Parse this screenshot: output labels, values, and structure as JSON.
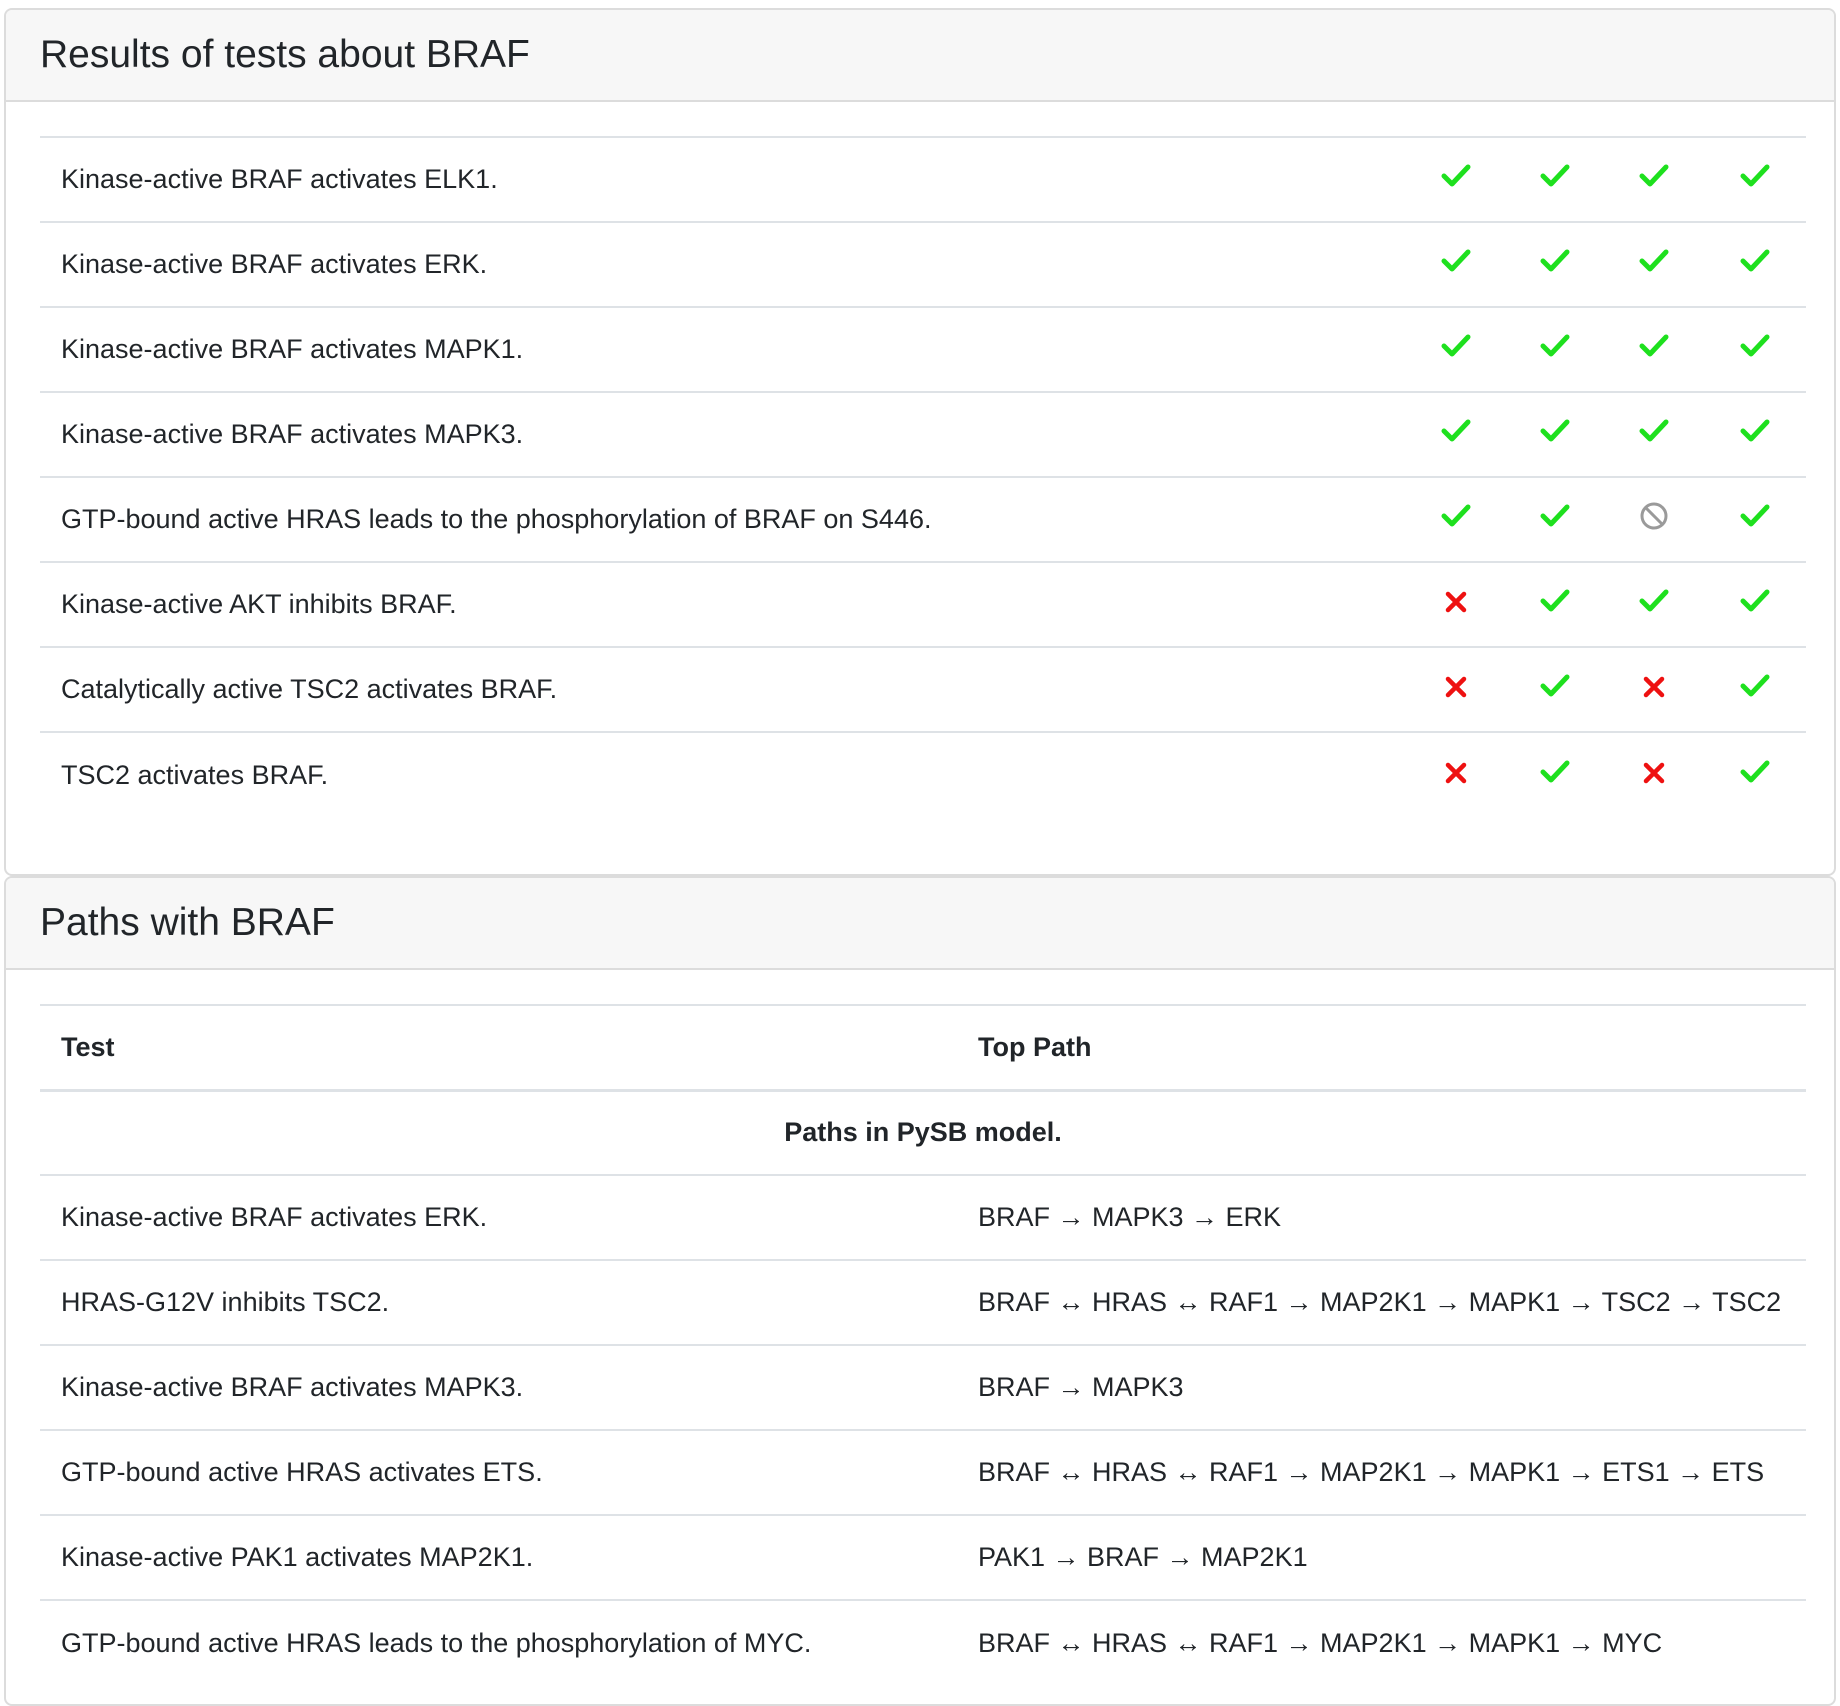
{
  "results_card": {
    "title": "Results of tests about BRAF",
    "rows": [
      {
        "test": "Kinase-active BRAF activates ELK1.",
        "results": [
          "pass",
          "pass",
          "pass",
          "pass"
        ]
      },
      {
        "test": "Kinase-active BRAF activates ERK.",
        "results": [
          "pass",
          "pass",
          "pass",
          "pass"
        ]
      },
      {
        "test": "Kinase-active BRAF activates MAPK1.",
        "results": [
          "pass",
          "pass",
          "pass",
          "pass"
        ]
      },
      {
        "test": "Kinase-active BRAF activates MAPK3.",
        "results": [
          "pass",
          "pass",
          "pass",
          "pass"
        ]
      },
      {
        "test": "GTP-bound active HRAS leads to the phosphorylation of BRAF on S446.",
        "results": [
          "pass",
          "pass",
          "not-applicable",
          "pass"
        ]
      },
      {
        "test": "Kinase-active AKT inhibits BRAF.",
        "results": [
          "fail",
          "pass",
          "pass",
          "pass"
        ]
      },
      {
        "test": "Catalytically active TSC2 activates BRAF.",
        "results": [
          "fail",
          "pass",
          "fail",
          "pass"
        ]
      },
      {
        "test": "TSC2 activates BRAF.",
        "results": [
          "fail",
          "pass",
          "fail",
          "pass"
        ]
      }
    ]
  },
  "paths_card": {
    "title": "Paths with BRAF",
    "headers": {
      "test": "Test",
      "path": "Top Path"
    },
    "group_label": "Paths in PySB model.",
    "rows": [
      {
        "test": "Kinase-active BRAF activates ERK.",
        "path": "BRAF → MAPK3 → ERK"
      },
      {
        "test": "HRAS-G12V inhibits TSC2.",
        "path": "BRAF ↔ HRAS ↔ RAF1 → MAP2K1 → MAPK1 → TSC2 → TSC2"
      },
      {
        "test": "Kinase-active BRAF activates MAPK3.",
        "path": "BRAF → MAPK3"
      },
      {
        "test": "GTP-bound active HRAS activates ETS.",
        "path": "BRAF ↔ HRAS ↔ RAF1 → MAP2K1 → MAPK1 → ETS1 → ETS"
      },
      {
        "test": "Kinase-active PAK1 activates MAP2K1.",
        "path": "PAK1 → BRAF → MAP2K1"
      },
      {
        "test": "GTP-bound active HRAS leads to the phosphorylation of MYC.",
        "path": "BRAF ↔ HRAS ↔ RAF1 → MAP2K1 → MAPK1 → MYC"
      }
    ]
  },
  "colors": {
    "pass": "#1ee01e",
    "fail": "#ee1111",
    "not-applicable": "#9a9a9a"
  }
}
